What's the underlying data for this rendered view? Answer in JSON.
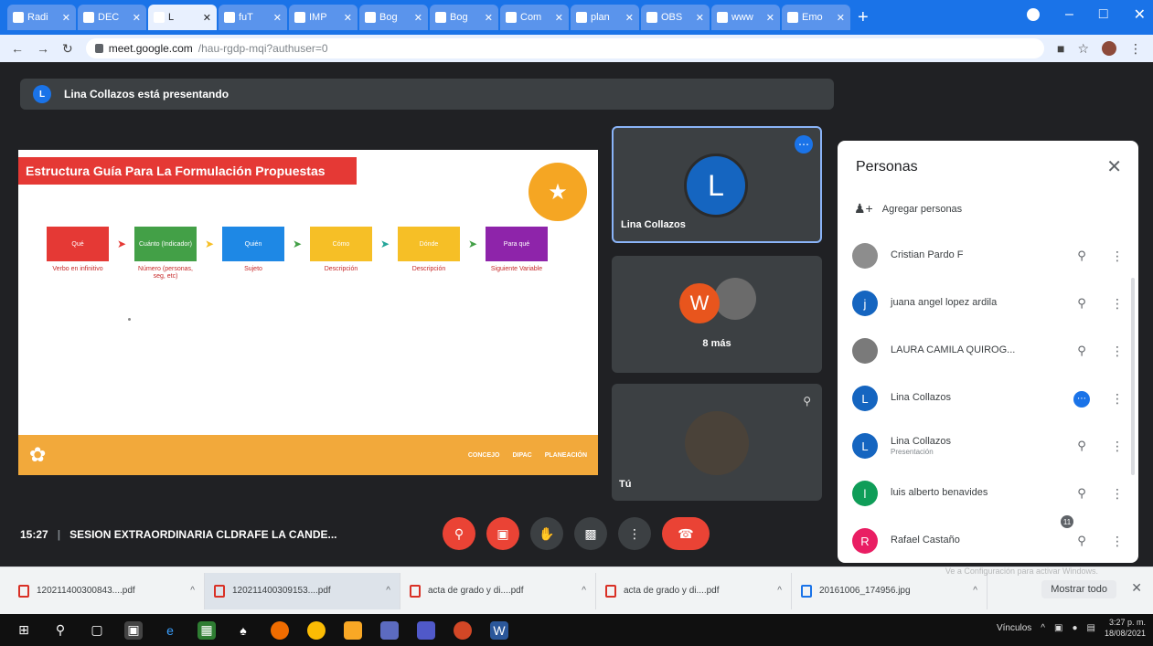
{
  "browser": {
    "tabs": [
      {
        "label": "Radi",
        "active": false
      },
      {
        "label": "DEC",
        "active": false
      },
      {
        "label": "L",
        "active": true
      },
      {
        "label": "fuT",
        "active": false
      },
      {
        "label": "IMP",
        "active": false
      },
      {
        "label": "Bog",
        "active": false
      },
      {
        "label": "Bog",
        "active": false
      },
      {
        "label": "Com",
        "active": false
      },
      {
        "label": "plan",
        "active": false
      },
      {
        "label": "OBS",
        "active": false
      },
      {
        "label": "www",
        "active": false
      },
      {
        "label": "Emo",
        "active": false
      }
    ],
    "new_tab": "+",
    "url_host": "meet.google.com",
    "url_path": "/hau-rgdp-mqi?authuser=0"
  },
  "meet": {
    "presenting_badge": "L",
    "presenting_text": "Lina Collazos está presentando",
    "slide": {
      "title": "Estructura Guía Para La Formulación Propuestas",
      "steps": [
        {
          "box": "Qué",
          "caption": "Verbo en infinitivo",
          "color": "#e53935"
        },
        {
          "box": "Cuánto (Indicador)",
          "caption": "Número (personas, seg, etc)",
          "color": "#43a047"
        },
        {
          "box": "Quién",
          "caption": "Sujeto",
          "color": "#1e88e5"
        },
        {
          "box": "Cómo",
          "caption": "Descripción",
          "color": "#f6bf26"
        },
        {
          "box": "Dónde",
          "caption": "Descripción",
          "color": "#f6bf26"
        },
        {
          "box": "Para qué",
          "caption": "Siguiente Variable",
          "color": "#8e24aa"
        }
      ],
      "arrow_colors": [
        "#e53935",
        "#f6bf26",
        "#43a047",
        "#26a69a",
        "#43a047"
      ],
      "footer_items": [
        "CONCEJO",
        "DIPAC",
        "PLANEACIÓN"
      ]
    },
    "tiles": {
      "main_initial": "L",
      "main_name": "Lina Collazos",
      "more_initial": "W",
      "more_text": "8 más",
      "self_name": "Tú"
    },
    "people": {
      "title": "Personas",
      "add_label": "Agregar personas",
      "list": [
        {
          "initial": "",
          "name": "Cristian Pardo F",
          "sub": "",
          "color": "#8d8d8d",
          "mic": "muted"
        },
        {
          "initial": "j",
          "name": "juana angel lopez ardila",
          "sub": "",
          "color": "#1565c0",
          "mic": "muted"
        },
        {
          "initial": "",
          "name": "LAURA CAMILA QUIROG...",
          "sub": "",
          "color": "#7a7a7a",
          "mic": "muted"
        },
        {
          "initial": "L",
          "name": "Lina Collazos",
          "sub": "",
          "color": "#1565c0",
          "mic": "speaking"
        },
        {
          "initial": "L",
          "name": "Lina Collazos",
          "sub": "Presentación",
          "color": "#1565c0",
          "mic": "muted"
        },
        {
          "initial": "l",
          "name": "luis alberto benavides",
          "sub": "",
          "color": "#0f9d58",
          "mic": "muted"
        },
        {
          "initial": "R",
          "name": "Rafael Castaño",
          "sub": "",
          "color": "#e91e63",
          "mic": "muted"
        }
      ]
    },
    "bottom": {
      "time": "15:27",
      "meeting_title": "SESION EXTRAORDINARIA CLDRAFE LA CANDE...",
      "participants_count": "11"
    },
    "watermark": "Activar Windows",
    "watermark_sub": "Ve a Configuración para activar Windows."
  },
  "downloads": {
    "items": [
      {
        "name": "120211400300843....pdf",
        "type": "pdf",
        "selected": false
      },
      {
        "name": "120211400309153....pdf",
        "type": "pdf",
        "selected": true
      },
      {
        "name": "acta de grado y di....pdf",
        "type": "pdf",
        "selected": false
      },
      {
        "name": "acta de grado y di....pdf",
        "type": "pdf",
        "selected": false
      },
      {
        "name": "20161006_174956.jpg",
        "type": "img",
        "selected": false
      }
    ],
    "show_all": "Mostrar todo"
  },
  "taskbar": {
    "tray_text": "Vínculos",
    "time": "3:27 p. m.",
    "date": "18/08/2021"
  }
}
